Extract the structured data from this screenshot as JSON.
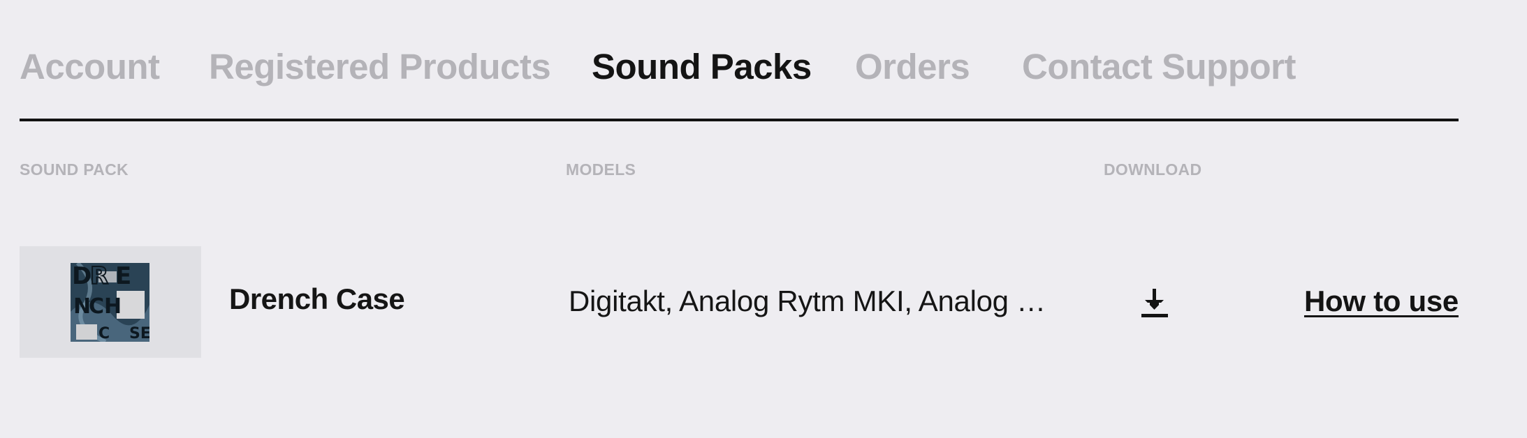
{
  "tabs": [
    {
      "label": "Account",
      "active": false
    },
    {
      "label": "Registered Products",
      "active": false
    },
    {
      "label": "Sound Packs",
      "active": true
    },
    {
      "label": "Orders",
      "active": false
    },
    {
      "label": "Contact Support",
      "active": false
    }
  ],
  "table": {
    "columns": {
      "sound_pack": "SOUND PACK",
      "models": "MODELS",
      "download": "DOWNLOAD"
    },
    "rows": [
      {
        "name": "Drench Case",
        "models": "Digitakt, Analog Rytm MKI, Analog R...",
        "cover_lettering": "DRENCH CASE",
        "download_icon": "download-icon",
        "link": "How to use"
      }
    ]
  },
  "colors": {
    "background": "#eeedf1",
    "text": "#141414",
    "muted": "#b4b3b8",
    "thumb_bg": "#e0e0e4"
  }
}
